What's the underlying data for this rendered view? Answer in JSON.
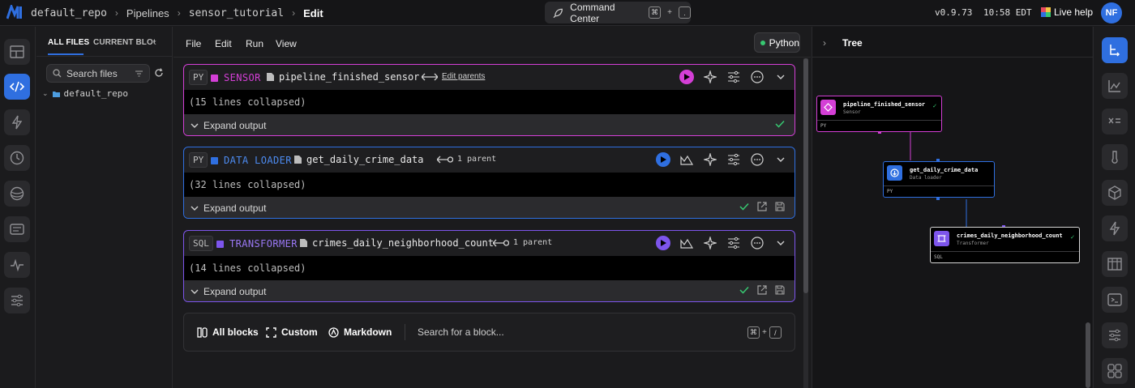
{
  "topbar": {
    "breadcrumbs": [
      "default_repo",
      "Pipelines",
      "sensor_tutorial",
      "Edit"
    ],
    "command_center": {
      "label": "Command Center",
      "shortcut_key": "⌘",
      "shortcut_plus": "+",
      "shortcut_char": "."
    },
    "version": "v0.9.73",
    "time": "10:58 EDT",
    "live_help": "Live help",
    "avatar_initials": "NF"
  },
  "file_panel": {
    "tabs": [
      "ALL FILES",
      "CURRENT BLOCK"
    ],
    "search_placeholder": "Search files",
    "tree_root": "default_repo"
  },
  "editor": {
    "menu": [
      "File",
      "Edit",
      "Run",
      "View"
    ],
    "kernel_language": "Python",
    "blocks": [
      {
        "lang": "PY",
        "type": "SENSOR",
        "name": "pipeline_finished_sensor",
        "relation": "Edit parents",
        "collapsed": "(15 lines collapsed)",
        "expand": "Expand output",
        "color": "#d43fd6"
      },
      {
        "lang": "PY",
        "type": "DATA LOADER",
        "name": "get_daily_crime_data",
        "relation": "1 parent",
        "collapsed": "(32 lines collapsed)",
        "expand": "Expand output",
        "color": "#2f6fe0"
      },
      {
        "lang": "SQL",
        "type": "TRANSFORMER",
        "name": "crimes_daily_neighborhood_count",
        "relation": "1 parent",
        "collapsed": "(14 lines collapsed)",
        "expand": "Expand output",
        "color": "#7d55ec"
      }
    ],
    "add_bar": {
      "all_blocks": "All blocks",
      "custom": "Custom",
      "markdown": "Markdown",
      "search_placeholder": "Search for a block...",
      "shortcut_key": "⌘",
      "shortcut_plus": "+",
      "shortcut_char": "/"
    }
  },
  "tree": {
    "title": "Tree",
    "nodes": [
      {
        "name": "pipeline_finished_sensor",
        "type": "Sensor",
        "lang": "PY"
      },
      {
        "name": "get_daily_crime_data",
        "type": "Data loader",
        "lang": "PY"
      },
      {
        "name": "crimes_daily_neighborhood_count",
        "type": "Transformer",
        "lang": "SQL"
      }
    ]
  },
  "colors": {
    "accent": "#2f6fe0",
    "sensor": "#d43fd6",
    "data_loader": "#2f6fe0",
    "transformer": "#7d55ec",
    "success": "#37c871"
  }
}
